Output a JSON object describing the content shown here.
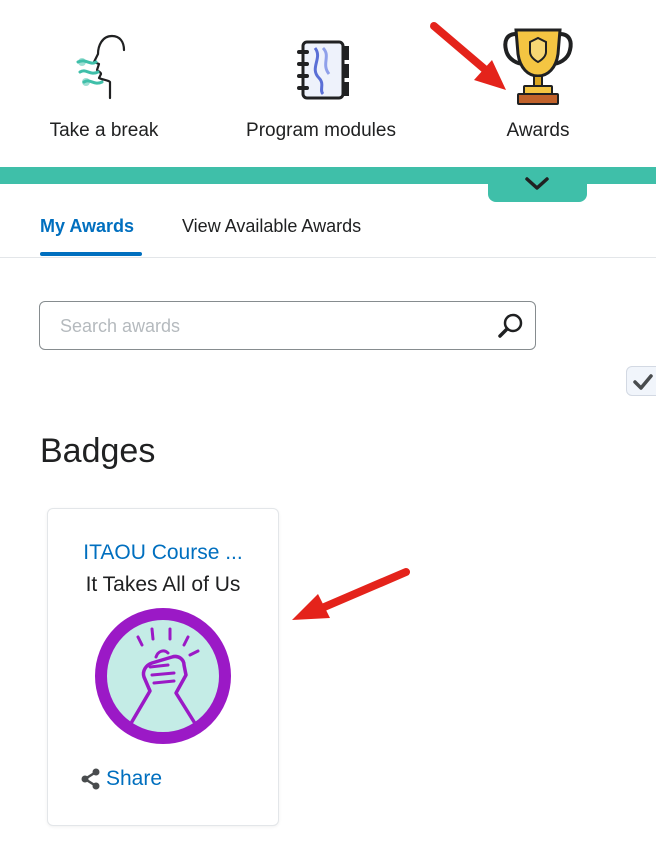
{
  "nav": {
    "items": [
      {
        "label": "Take a break",
        "icon": "breathing-face-icon"
      },
      {
        "label": "Program modules",
        "icon": "notebook-icon"
      },
      {
        "label": "Awards",
        "icon": "trophy-icon"
      }
    ],
    "collapse_icon": "chevron-down-icon",
    "accent_color": "#3fbfa9"
  },
  "tabs": [
    {
      "label": "My Awards",
      "active": true
    },
    {
      "label": "View Available Awards",
      "active": false
    }
  ],
  "search": {
    "placeholder": "Search awards",
    "value": "",
    "icon": "search-icon"
  },
  "toggle": {
    "icon": "checkmark-icon",
    "checked": true
  },
  "badges": {
    "section_title": "Badges",
    "items": [
      {
        "title": "ITAOU Course ...",
        "name": "It Takes All of Us",
        "image_icon": "clasped-hands-badge-icon",
        "share_label": "Share",
        "share_icon": "share-icon"
      }
    ]
  },
  "colors": {
    "link": "#006fbf",
    "badge_ring": "#9b19c6",
    "badge_fill": "#c4ece6",
    "arrow": "#e4231b"
  }
}
